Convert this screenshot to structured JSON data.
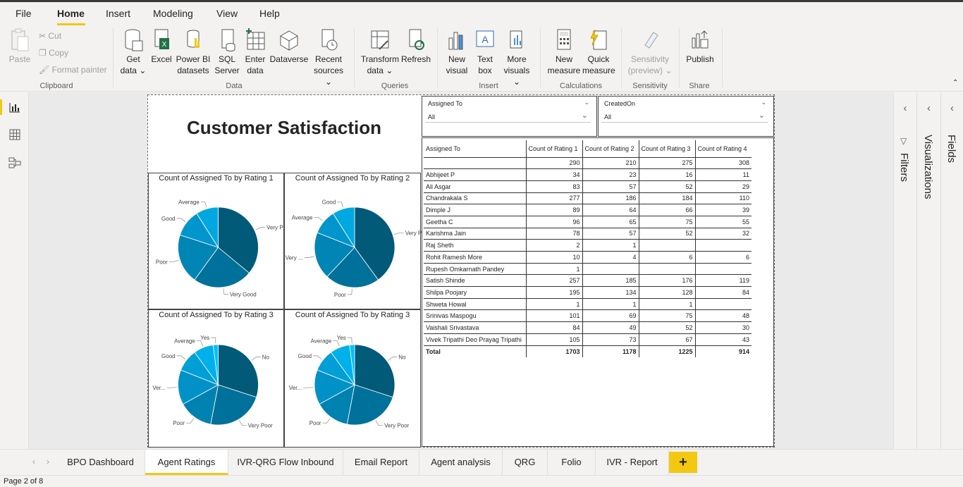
{
  "menu": {
    "items": [
      "File",
      "Home",
      "Insert",
      "Modeling",
      "View",
      "Help"
    ],
    "active": "Home"
  },
  "ribbon": {
    "clipboard": {
      "paste": "Paste",
      "cut": "Cut",
      "copy": "Copy",
      "format_painter": "Format painter",
      "label": "Clipboard"
    },
    "data": {
      "get_data_1": "Get",
      "get_data_2": "data",
      "excel": "Excel",
      "powerbi_1": "Power BI",
      "powerbi_2": "datasets",
      "sql_1": "SQL",
      "sql_2": "Server",
      "enter_1": "Enter",
      "enter_2": "data",
      "dataverse": "Dataverse",
      "recent_1": "Recent",
      "recent_2": "sources",
      "label": "Data"
    },
    "queries": {
      "transform_1": "Transform",
      "transform_2": "data",
      "refresh": "Refresh",
      "label": "Queries"
    },
    "insert": {
      "new_visual_1": "New",
      "new_visual_2": "visual",
      "text_box_1": "Text",
      "text_box_2": "box",
      "more_1": "More",
      "more_2": "visuals",
      "label": "Insert"
    },
    "calculations": {
      "new_measure_1": "New",
      "new_measure_2": "measure",
      "quick_measure_1": "Quick",
      "quick_measure_2": "measure",
      "label": "Calculations"
    },
    "sensitivity": {
      "btn_1": "Sensitivity",
      "btn_2": "(preview)",
      "label": "Sensitivity"
    },
    "share": {
      "publish": "Publish",
      "label": "Share"
    }
  },
  "report": {
    "title": "Customer Satisfaction",
    "slicers": [
      {
        "label": "Assigned To",
        "value": "All"
      },
      {
        "label": "CreatedOn",
        "value": "All"
      }
    ],
    "table": {
      "headers": [
        "Assigned To",
        "Count of Rating 1",
        "Count of Rating 2",
        "Count of Rating 3",
        "Count of Rating 4"
      ],
      "rows": [
        [
          "",
          "290",
          "210",
          "275",
          "308"
        ],
        [
          "Abhijeet P",
          "34",
          "23",
          "16",
          "11"
        ],
        [
          "Ali Asgar",
          "83",
          "57",
          "52",
          "29"
        ],
        [
          "Chandrakala S",
          "277",
          "186",
          "184",
          "110"
        ],
        [
          "Dimple J",
          "89",
          "64",
          "66",
          "39"
        ],
        [
          "Geetha C",
          "96",
          "65",
          "75",
          "55"
        ],
        [
          "Karishma Jain",
          "78",
          "57",
          "52",
          "32"
        ],
        [
          "Raj Sheth",
          "2",
          "1",
          "",
          ""
        ],
        [
          "Rohit Ramesh More",
          "10",
          "4",
          "6",
          "6"
        ],
        [
          "Rupesh Omkarnath Pandey",
          "1",
          "",
          "",
          ""
        ],
        [
          "Satish Shinde",
          "257",
          "185",
          "176",
          "119"
        ],
        [
          "Shilpa Poojary",
          "195",
          "134",
          "128",
          "84"
        ],
        [
          "Shweta Howal",
          "1",
          "1",
          "1",
          ""
        ],
        [
          "Srinivas Maspogu",
          "101",
          "69",
          "75",
          "48"
        ],
        [
          "Vaishali Srivastava",
          "84",
          "49",
          "52",
          "30"
        ],
        [
          "Vivek Tripathi Deo Prayag Tripathi",
          "105",
          "73",
          "67",
          "43"
        ]
      ],
      "total": [
        "Total",
        "1703",
        "1178",
        "1225",
        "914"
      ]
    }
  },
  "chart_data": [
    {
      "type": "pie",
      "title": "Count of Assigned To by Rating 1",
      "categories": [
        "Very Poor",
        "Very Good",
        "Poor",
        "Good",
        "Average"
      ],
      "values": [
        36,
        24,
        20,
        11,
        9
      ],
      "colors": [
        "#005a78",
        "#00719a",
        "#0085b5",
        "#0096cc",
        "#00a8e0"
      ]
    },
    {
      "type": "pie",
      "title": "Count of Assigned To by Rating 2",
      "categories": [
        "Very Poor",
        "Poor",
        "Very ...",
        "Average",
        "Good"
      ],
      "values": [
        40,
        22,
        19,
        10,
        9
      ],
      "colors": [
        "#005a78",
        "#00719a",
        "#0085b5",
        "#0096cc",
        "#00a8e0"
      ]
    },
    {
      "type": "pie",
      "title": "Count of Assigned To by Rating 3",
      "categories": [
        "No",
        "Very Poor",
        "Poor",
        "Ver...",
        "Good",
        "Average",
        "Yes"
      ],
      "values": [
        30,
        23,
        14,
        14,
        9,
        8,
        2
      ],
      "colors": [
        "#005a78",
        "#00719a",
        "#0082b0",
        "#0092c6",
        "#009fd6",
        "#00b0ea",
        "#00c0f5"
      ]
    },
    {
      "type": "pie",
      "title": "Count of Assigned To by Rating 3",
      "categories": [
        "No",
        "Very Poor",
        "Poor",
        "Ver...",
        "Good",
        "Average",
        "Yes"
      ],
      "values": [
        30,
        23,
        14,
        14,
        9,
        8,
        2
      ],
      "colors": [
        "#005a78",
        "#00719a",
        "#0082b0",
        "#0092c6",
        "#009fd6",
        "#00b0ea",
        "#00c0f5"
      ]
    }
  ],
  "right_panes": {
    "filters": "Filters",
    "visualizations": "Visualizations",
    "fields": "Fields"
  },
  "tabs": {
    "items": [
      "BPO Dashboard",
      "Agent Ratings",
      "IVR-QRG Flow Inbound",
      "Email Report",
      "Agent analysis",
      "QRG",
      "Folio",
      "IVR - Report"
    ],
    "active": "Agent Ratings",
    "add": "+"
  },
  "status": {
    "page": "Page 2 of 8"
  },
  "colors": {
    "accent": "#f2c811"
  }
}
